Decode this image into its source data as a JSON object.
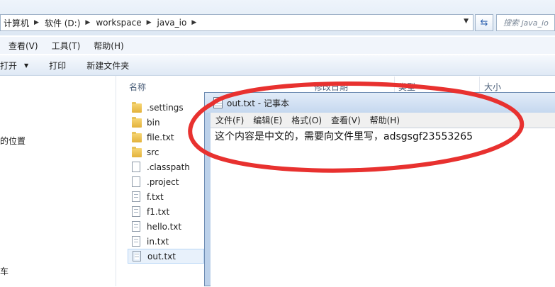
{
  "address_bar": {
    "crumbs": [
      "计算机",
      "软件 (D:)",
      "workspace",
      "java_io"
    ],
    "search_placeholder": "搜索 java_io"
  },
  "menu": {
    "items": [
      "查看(V)",
      "工具(T)",
      "帮助(H)"
    ]
  },
  "toolbar": {
    "open_label": "打开",
    "print_label": "打印",
    "new_folder_label": "新建文件夹"
  },
  "nav_pane": {
    "partial_item_1": "的位置",
    "partial_item_2": "车"
  },
  "columns": {
    "name": "名称",
    "modified": "修改日期",
    "type": "类型",
    "size": "大小"
  },
  "files": [
    {
      "name": ".settings",
      "kind": "folder"
    },
    {
      "name": "bin",
      "kind": "folder"
    },
    {
      "name": "file.txt",
      "kind": "folder"
    },
    {
      "name": "src",
      "kind": "folder"
    },
    {
      "name": ".classpath",
      "kind": "file"
    },
    {
      "name": ".project",
      "kind": "file"
    },
    {
      "name": "f.txt",
      "kind": "text"
    },
    {
      "name": "f1.txt",
      "kind": "text"
    },
    {
      "name": "hello.txt",
      "kind": "text"
    },
    {
      "name": "in.txt",
      "kind": "text"
    },
    {
      "name": "out.txt",
      "kind": "text",
      "selected": true
    }
  ],
  "notepad": {
    "title": "out.txt - 记事本",
    "menu": [
      "文件(F)",
      "编辑(E)",
      "格式(O)",
      "查看(V)",
      "帮助(H)"
    ],
    "content": "这个内容是中文的，需要向文件里写，adsgsgf23553265"
  },
  "colors": {
    "annotation_ring": "#e8312f",
    "accent": "#2f63b0"
  }
}
